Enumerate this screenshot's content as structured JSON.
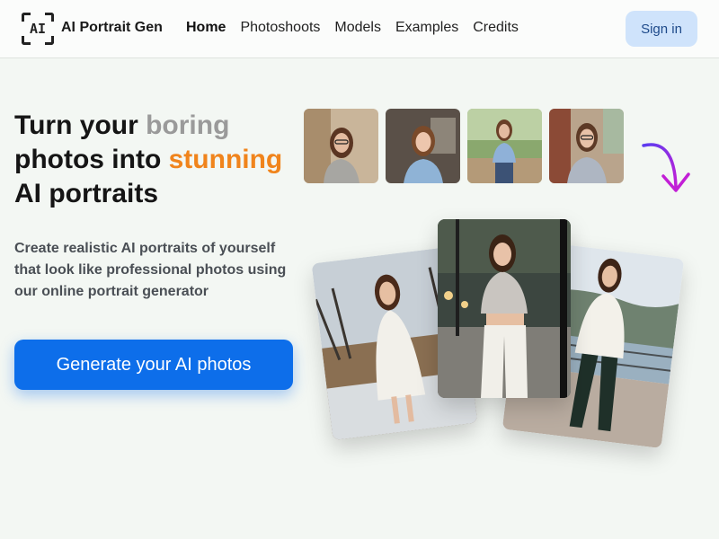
{
  "header": {
    "logo_text": "AI",
    "brand": "AI Portrait Gen",
    "nav": [
      {
        "label": "Home",
        "active": true
      },
      {
        "label": "Photoshoots",
        "active": false
      },
      {
        "label": "Models",
        "active": false
      },
      {
        "label": "Examples",
        "active": false
      },
      {
        "label": "Credits",
        "active": false
      }
    ],
    "signin_label": "Sign in"
  },
  "hero": {
    "headline": {
      "part1": "Turn your ",
      "highlight1": "boring",
      "part2": "photos into ",
      "highlight2": "stunning",
      "part3": "AI portraits"
    },
    "subtext": "Create realistic AI portraits of yourself that look like professional photos using our online portrait generator",
    "cta_label": "Generate your AI photos"
  },
  "thumbnails": [
    {
      "subject": "woman-glasses-gray-sweater-indoor"
    },
    {
      "subject": "woman-blue-shirt-office"
    },
    {
      "subject": "woman-denim-outdoor"
    },
    {
      "subject": "woman-glasses-cardigan-street"
    }
  ],
  "generated_photos": [
    {
      "subject": "woman-white-dress-winter-park"
    },
    {
      "subject": "woman-crop-top-street"
    },
    {
      "subject": "woman-sweater-waterfront"
    }
  ],
  "colors": {
    "accent": "#0d6eea",
    "highlight_gray": "#9a9a9a",
    "highlight_orange": "#f0841c",
    "arrow": "#8a2be2",
    "signin_bg": "#cfe3fb"
  },
  "icons": {
    "logo": "ai-frame-icon",
    "arrow": "curved-arrow-down-icon"
  }
}
